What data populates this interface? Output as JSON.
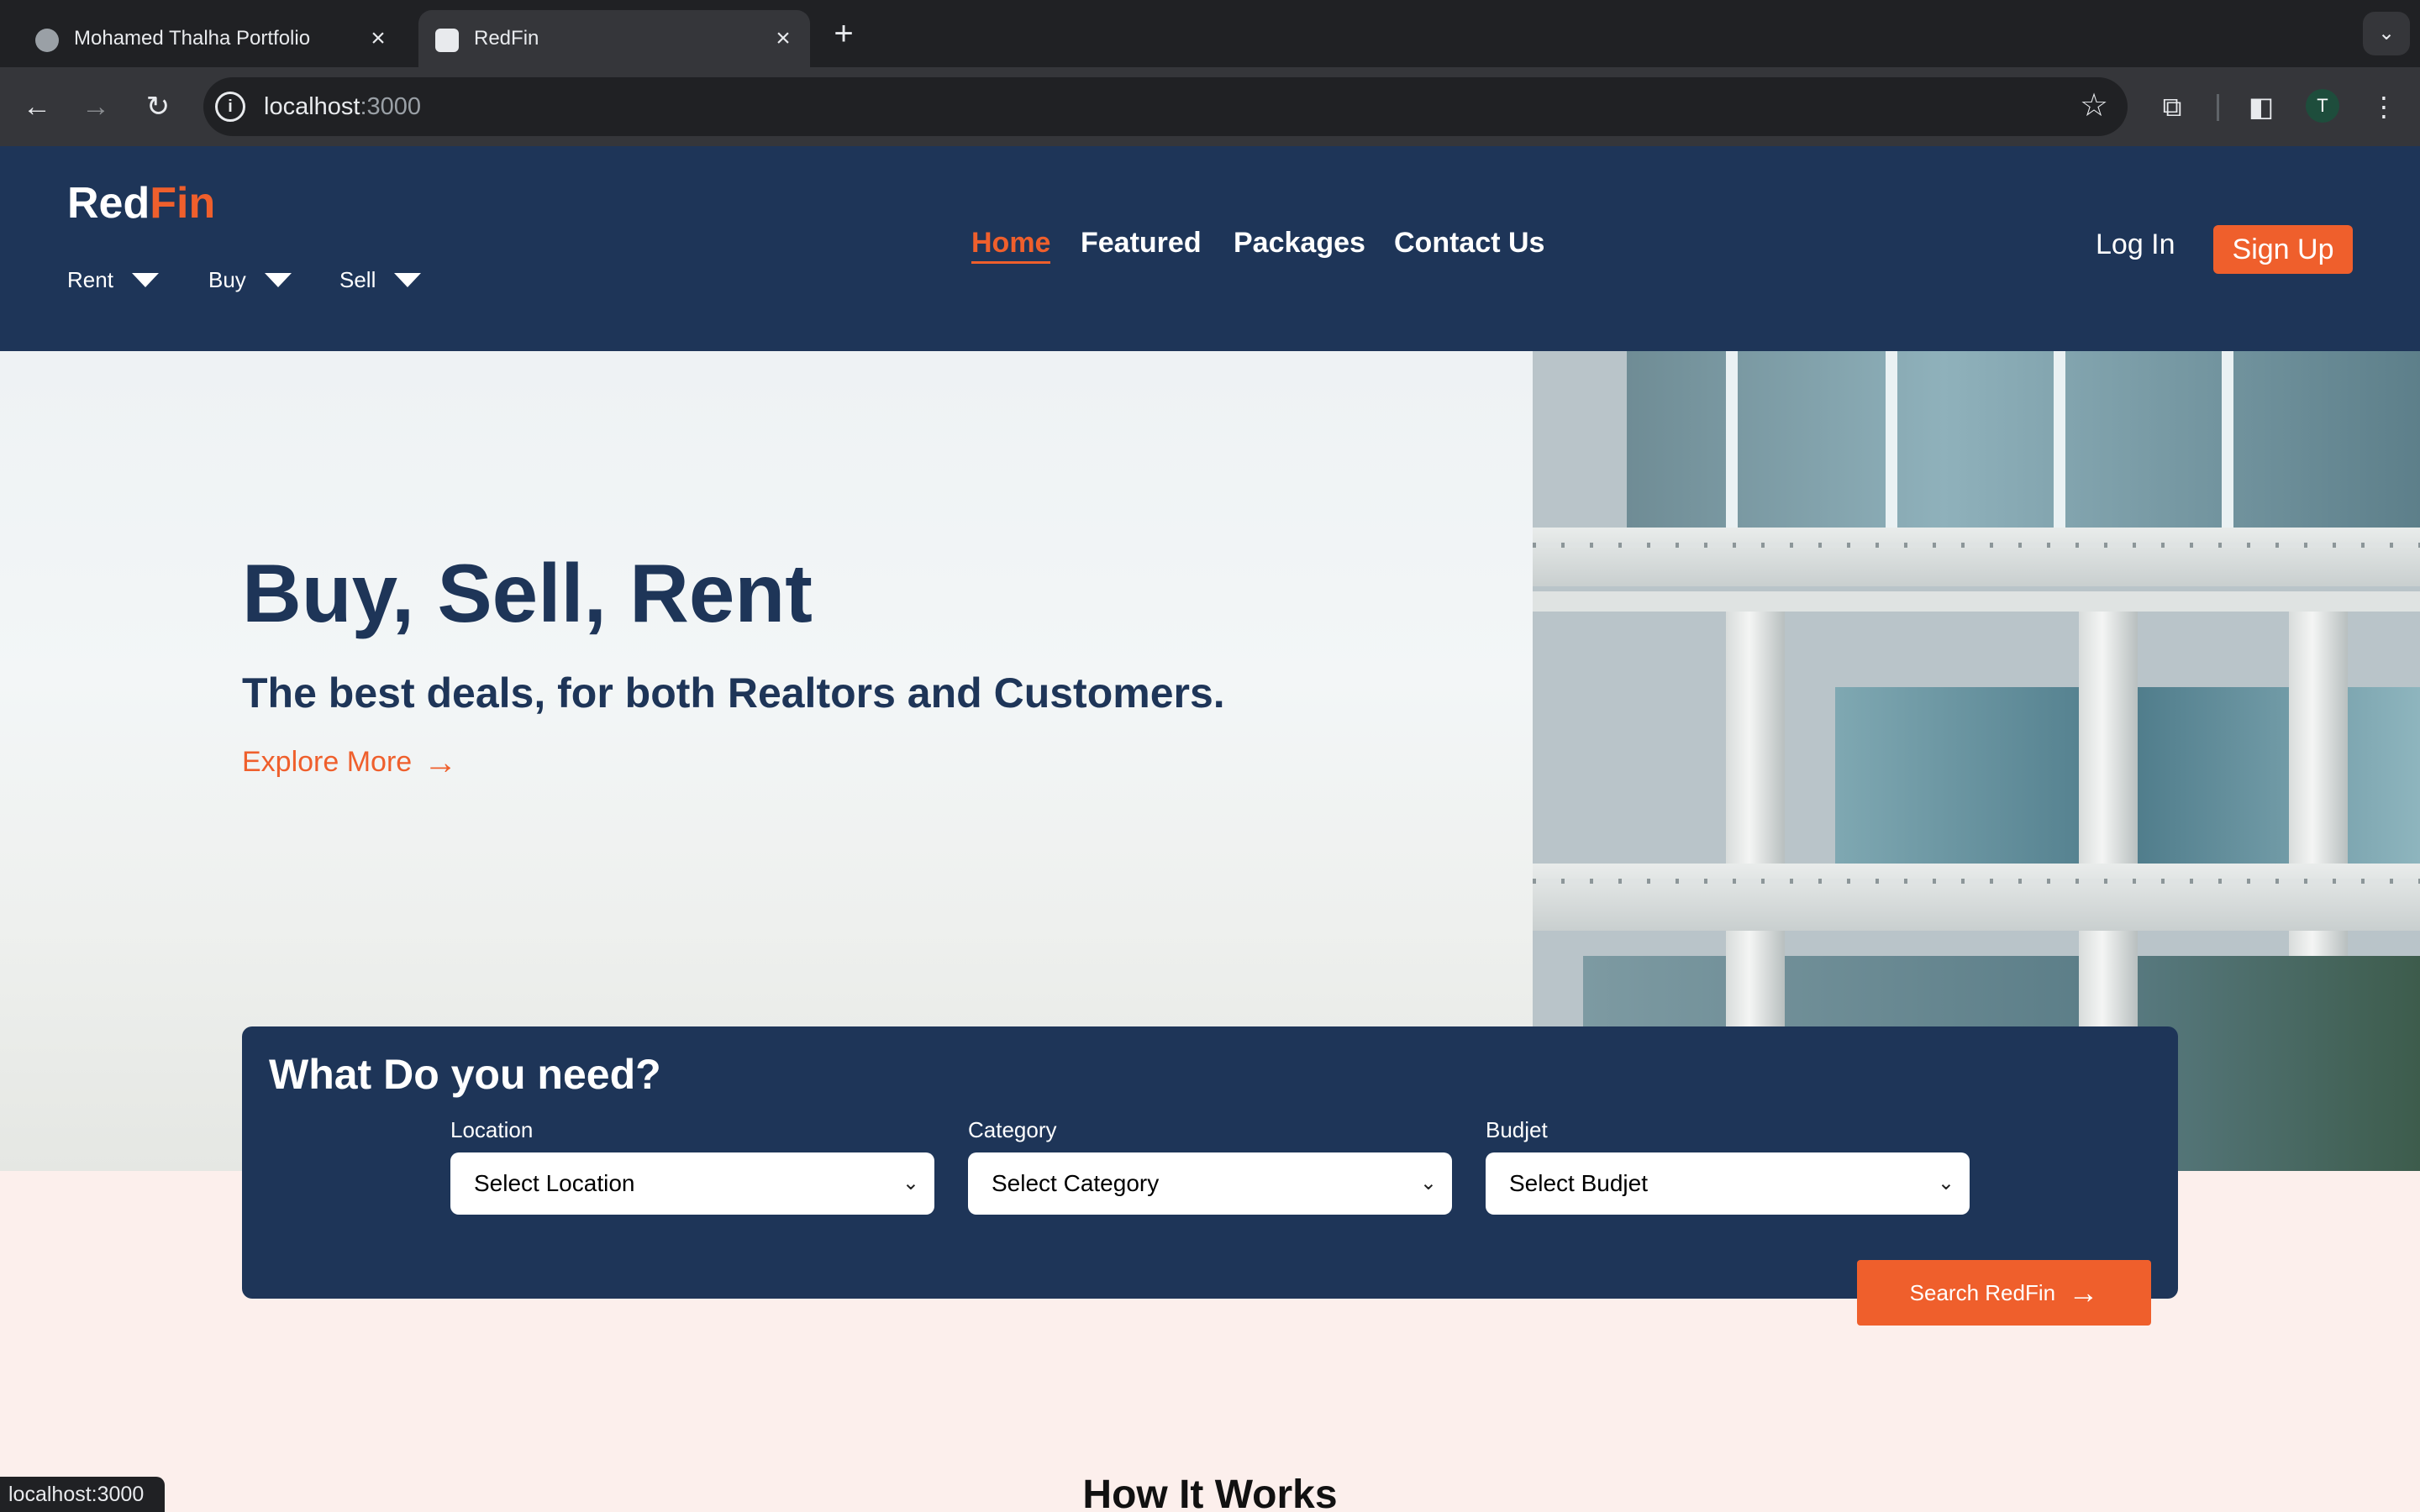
{
  "browser": {
    "tabs": [
      {
        "title": "Mohamed Thalha Portfolio",
        "active": false,
        "icon": "globe-icon"
      },
      {
        "title": "RedFin",
        "active": true,
        "icon": "house-favicon-icon"
      }
    ],
    "new_tab_symbol": "+",
    "close_symbol": "×",
    "address": {
      "host": "localhost",
      "port": ":3000"
    },
    "profile_initial": "T",
    "status_url": "localhost:3000"
  },
  "site": {
    "logo": {
      "part1": "Red",
      "part2": "Fin"
    },
    "dropdowns": [
      {
        "label": "Rent"
      },
      {
        "label": "Buy"
      },
      {
        "label": "Sell"
      }
    ],
    "nav": [
      {
        "label": "Home",
        "active": true
      },
      {
        "label": "Featured"
      },
      {
        "label": "Packages"
      },
      {
        "label": "Contact Us"
      }
    ],
    "login_label": "Log In",
    "signup_label": "Sign Up"
  },
  "hero": {
    "title": "Buy, Sell, Rent",
    "subtitle": "The best deals, for both Realtors and Customers.",
    "cta_label": "Explore More",
    "cta_arrow": "→"
  },
  "search": {
    "heading": "What Do you need?",
    "fields": [
      {
        "label": "Location",
        "selected": "Select Location"
      },
      {
        "label": "Category",
        "selected": "Select Category"
      },
      {
        "label": "Budjet",
        "selected": "Select Budjet"
      }
    ],
    "button_label": "Search RedFin",
    "button_arrow": "→"
  },
  "section": {
    "how_it_works": "How It Works"
  },
  "colors": {
    "navy": "#1e3558",
    "accent": "#ef5f2c",
    "page_bg": "#fcefec"
  }
}
